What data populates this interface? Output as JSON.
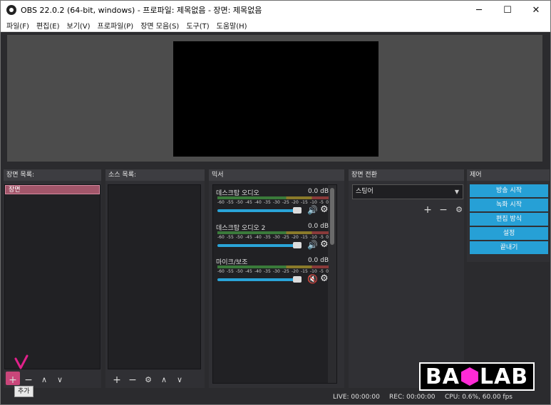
{
  "window": {
    "title": "OBS 22.0.2 (64-bit, windows) - 프로파일: 제목없음 - 장면: 제목없음",
    "minimize": "─",
    "maximize": "☐",
    "close": "✕"
  },
  "menu": [
    "파일(F)",
    "편집(E)",
    "보기(V)",
    "프로파일(P)",
    "장면 모음(S)",
    "도구(T)",
    "도움말(H)"
  ],
  "docks": {
    "scenes": {
      "title": "장면 목록:",
      "items": [
        "장면"
      ]
    },
    "sources": {
      "title": "소스 목록:"
    },
    "mixer": {
      "title": "믹서"
    },
    "transitions": {
      "title": "장면 전환",
      "selected": "스팅어"
    },
    "controls": {
      "title": "제어",
      "buttons": [
        "방송 시작",
        "녹화 시작",
        "편집 방식",
        "설정",
        "끝내기"
      ]
    }
  },
  "mixer": {
    "ticks": [
      "-60",
      "-55",
      "-50",
      "-45",
      "-40",
      "-35",
      "-30",
      "-25",
      "-20",
      "-15",
      "-10",
      "-5",
      "0"
    ],
    "channels": [
      {
        "name": "데스크탑 오디오",
        "db": "0.0 dB",
        "muted": false
      },
      {
        "name": "데스크탑 오디오 2",
        "db": "0.0 dB",
        "muted": false
      },
      {
        "name": "마이크/보조",
        "db": "0.0 dB",
        "muted": true
      }
    ]
  },
  "toolbar": {
    "add": "+",
    "remove": "−",
    "gear": "⚙",
    "up": "∧",
    "down": "∨"
  },
  "tooltip": "추가",
  "status": {
    "live": "LIVE: 00:00:00",
    "rec": "REC: 00:00:00",
    "cpu": "CPU: 0.6%, 60.00 fps"
  },
  "logo": {
    "left": "BA",
    "right": "LAB"
  },
  "colors": {
    "accent": "#26a0d6",
    "scene_selected": "#a2566a",
    "annotation": "#e0218a"
  }
}
